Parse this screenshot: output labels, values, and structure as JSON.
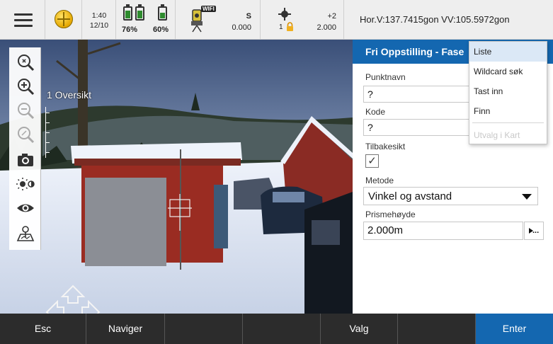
{
  "status_bar": {
    "menu_icon": "hamburger-menu-icon",
    "gnss_icon": "globe-icon",
    "time": "1:40",
    "date": "12/10",
    "battery_1_percent": "76%",
    "battery_2_percent": "60%",
    "battery_1_level": 0.76,
    "battery_2_level": 0.6,
    "wifi_badge": "WIFI",
    "instrument_mode": "S",
    "instrument_value": "0.000",
    "target_offset": "+2",
    "target_number": "1",
    "target_height": "2.000",
    "angles": "Hor.V:137.7415gon  VV:105.5972gon"
  },
  "camera_view": {
    "title": "1 Oversikt",
    "tools": [
      "zoom-fit-icon",
      "zoom-in-icon",
      "zoom-out-icon",
      "zoom-reset-icon",
      "camera-icon",
      "brightness-icon",
      "eye-icon",
      "survey-map-icon"
    ]
  },
  "panel": {
    "title": "Fri Oppstilling - Fase",
    "point_name_label": "Punktnavn",
    "point_name_value": "?",
    "code_label": "Kode",
    "code_value": "?",
    "backsight_label": "Tilbakesikt",
    "backsight_checked": "✓",
    "method_label": "Metode",
    "method_value": "Vinkel og avstand",
    "prism_height_label": "Prismehøyde",
    "prism_height_value": "2.000m"
  },
  "dropdown": {
    "items": [
      {
        "label": "Liste",
        "state": "highlighted"
      },
      {
        "label": "Wildcard søk",
        "state": "enabled"
      },
      {
        "label": "Tast inn",
        "state": "enabled"
      },
      {
        "label": "Finn",
        "state": "enabled"
      },
      {
        "label": "Utvalg i Kart",
        "state": "disabled"
      }
    ]
  },
  "softkeys": {
    "esc": "Esc",
    "navigate": "Naviger",
    "select": "Valg",
    "enter": "Enter"
  },
  "colors": {
    "accent": "#1467b0",
    "softkey_bar": "#2c2c2c",
    "status_bar": "#eeeeee",
    "highlight": "#dbe8f6"
  }
}
